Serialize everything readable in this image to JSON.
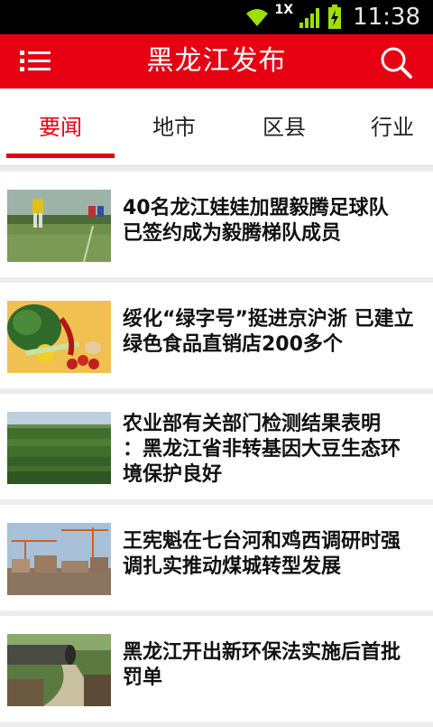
{
  "status_bar": {
    "network_label": "1X",
    "time": "11:38"
  },
  "app_bar": {
    "title": "黑龙江发布",
    "menu_icon": "list-menu-icon",
    "search_icon": "search-icon",
    "color": "#e60012"
  },
  "tabs": [
    {
      "label": "要闻",
      "active": true
    },
    {
      "label": "地市",
      "active": false
    },
    {
      "label": "区县",
      "active": false
    },
    {
      "label": "行业",
      "active": false
    }
  ],
  "news": [
    {
      "title": "40名龙江娃娃加盟毅腾足球队 已签约成为毅腾梯队成员",
      "line1": "40名龙江娃娃加盟毅腾足球队",
      "line2": "已签约成为毅腾梯队成员",
      "line3": ""
    },
    {
      "title": "绥化“绿字号”挺进京沪浙 已建立绿色食品直销店200多个",
      "line1": "绥化“绿字号”挺进京沪浙  已建立",
      "line2": "绿色食品直销店200多个",
      "line3": ""
    },
    {
      "title": "农业部有关部门检测结果表明：黑龙江省非转基因大豆生态环境保护良好",
      "line1": "农业部有关部门检测结果表明",
      "line2": "：黑龙江省非转基因大豆生态环",
      "line3": "境保护良好"
    },
    {
      "title": "王宪魁在七台河和鸡西调研时强调扎实推动煤城转型发展",
      "line1": "王宪魁在七台河和鸡西调研时强",
      "line2": "调扎实推动煤城转型发展",
      "line3": ""
    },
    {
      "title": "黑龙江开出新环保法实施后首批罚单",
      "line1": "黑龙江开出新环保法实施后首批",
      "line2": "罚单",
      "line3": ""
    }
  ]
}
